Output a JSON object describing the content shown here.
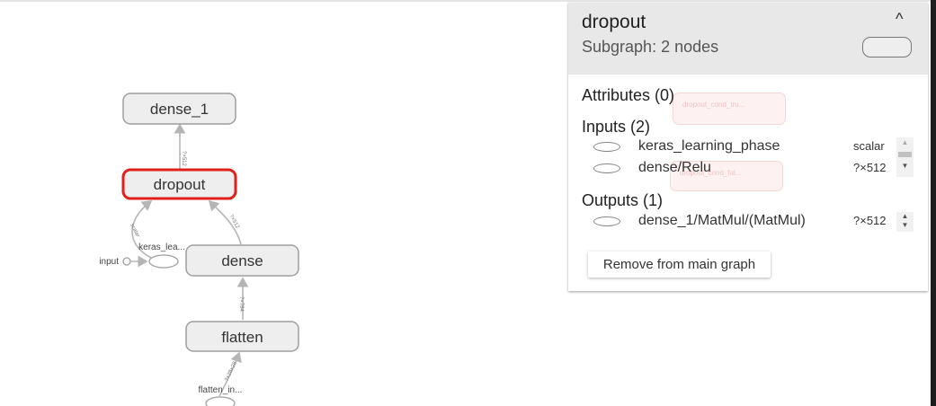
{
  "graph": {
    "nodes": {
      "dense_1": "dense_1",
      "dropout": "dropout",
      "dense": "dense",
      "flatten": "flatten",
      "keras_learning": "keras_lea...",
      "input": "input",
      "flatten_input": "flatten_in..."
    },
    "edge_labels": {
      "dropout_to_dense_1": "?×512",
      "dense_to_dropout": "?×512",
      "flatten_to_dense": "?×784",
      "keras_to_dropout": "scalar",
      "flatten_input_to_flatten": "?×28×28"
    },
    "selected_node": "dropout",
    "selected_color": "#e0201b"
  },
  "panel": {
    "title": "dropout",
    "subtitle": "Subgraph: 2 nodes",
    "collapse_icon": "^",
    "attributes_title": "Attributes (0)",
    "inputs_title": "Inputs (2)",
    "inputs": [
      {
        "name": "keras_learning_phase",
        "shape": "scalar"
      },
      {
        "name": "dense/Relu",
        "shape": "?×512"
      }
    ],
    "outputs_title": "Outputs (1)",
    "outputs": [
      {
        "name": "dense_1/MatMul/(MatMul)",
        "shape": "?×512"
      }
    ],
    "remove_button": "Remove from main graph",
    "ghost_labels": [
      "dropout_cond_tru...",
      "dropout_cond_fal..."
    ]
  }
}
